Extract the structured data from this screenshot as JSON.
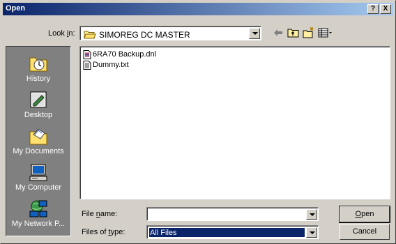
{
  "window": {
    "title": "Open",
    "help_label": "?",
    "close_label": "X"
  },
  "lookin": {
    "label_pre": "Look ",
    "label_u": "i",
    "label_post": "n:",
    "value": "SIMOREG DC MASTER"
  },
  "places": [
    {
      "label": "History",
      "icon": "history-icon"
    },
    {
      "label": "Desktop",
      "icon": "desktop-icon"
    },
    {
      "label": "My Documents",
      "icon": "my-documents-icon"
    },
    {
      "label": "My Computer",
      "icon": "my-computer-icon"
    },
    {
      "label": "My Network P...",
      "icon": "my-network-places-icon"
    }
  ],
  "files": [
    {
      "name": "6RA70 Backup.dnl",
      "icon": "dnl-file-icon"
    },
    {
      "name": "Dummy.txt",
      "icon": "text-file-icon"
    }
  ],
  "filename": {
    "label_pre": "File ",
    "label_u": "n",
    "label_post": "ame:",
    "value": ""
  },
  "filetype": {
    "label_pre": "Files of ",
    "label_u": "t",
    "label_post": "ype:",
    "value": "All Files"
  },
  "buttons": {
    "open_u": "O",
    "open_rest": "pen",
    "cancel": "Cancel"
  },
  "colors": {
    "titlebar_start": "#0a246a",
    "titlebar_end": "#a6caf0",
    "face": "#d4d0c8",
    "places_bg": "#808080"
  }
}
